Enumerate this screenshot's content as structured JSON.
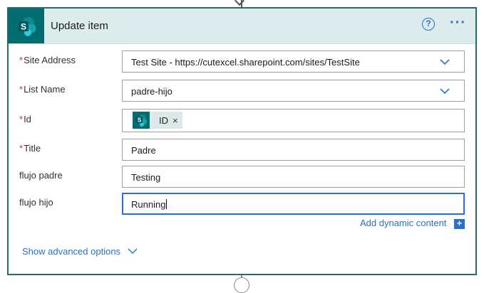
{
  "card": {
    "title": "Update item",
    "help_icon": "question-circle-icon",
    "more_icon": "ellipsis-icon",
    "connector_icon": "sharepoint-icon"
  },
  "colors": {
    "brand": "#036c70",
    "header_bg": "#dcebeb",
    "border": "#1f6e6a",
    "link": "#2a6fc9",
    "required": "#c4314b"
  },
  "fields": {
    "site_address": {
      "label": "Site Address",
      "required": "*",
      "value": "Test Site - https://cutexcel.sharepoint.com/sites/TestSite"
    },
    "list_name": {
      "label": "List Name",
      "required": "*",
      "value": "padre-hijo"
    },
    "id": {
      "label": "Id",
      "required": "*",
      "token_label": "ID",
      "token_remove": "×"
    },
    "title": {
      "label": "Title",
      "required": "*",
      "value": "Padre"
    },
    "flujo_padre": {
      "label": "flujo padre",
      "value": "Testing"
    },
    "flujo_hijo": {
      "label": "flujo hijo",
      "value": "Running"
    }
  },
  "dynamic_content": {
    "label": "Add dynamic content",
    "icon": "+"
  },
  "advanced": {
    "label": "Show advanced options"
  }
}
